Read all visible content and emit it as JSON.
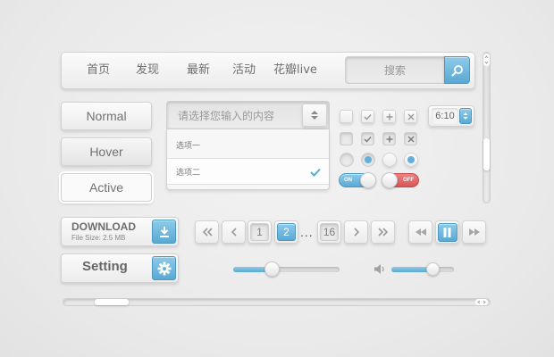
{
  "nav": {
    "items": [
      "首页",
      "发现",
      "最新",
      "活动",
      "花瓣live"
    ],
    "search_placeholder": "搜索"
  },
  "states": {
    "normal": "Normal",
    "hover": "Hover",
    "active": "Active"
  },
  "select": {
    "placeholder": "请选择您输入的内容",
    "options": [
      "选项一",
      "选项二"
    ],
    "selected_index": 1
  },
  "toggles": {
    "on_label": "ON",
    "off_label": "OFF"
  },
  "time": {
    "value": "6:10"
  },
  "download": {
    "title": "DOWNLOAD",
    "size": "File Size: 2.5 MB"
  },
  "setting": {
    "label": "Setting"
  },
  "pagination": {
    "pages": [
      "1",
      "2",
      "16"
    ],
    "ellipsis": "...",
    "current": "2"
  },
  "sliders": {
    "progress_fraction": 0.36,
    "volume_fraction": 0.65
  },
  "scroll": {
    "vertical_fraction": 0.68,
    "horizontal_fraction": 0.08
  },
  "colors": {
    "accent": "#6ab6dd",
    "toggle_off": "#e06464",
    "background": "#ececec"
  }
}
